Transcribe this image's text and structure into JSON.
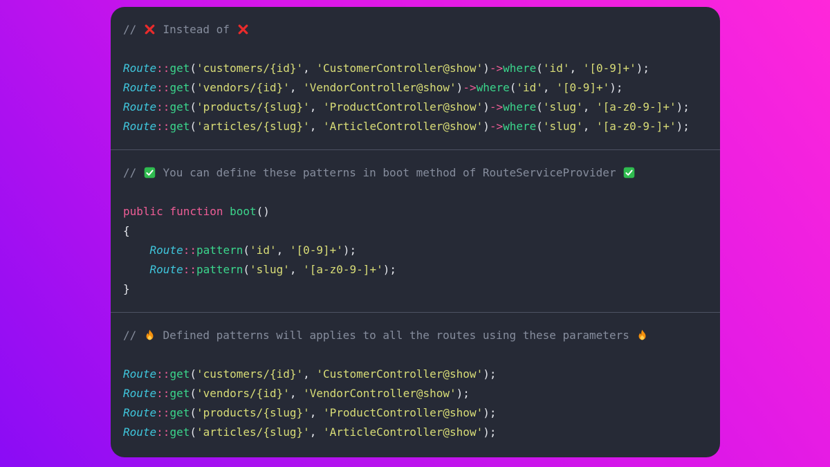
{
  "background": {
    "gradient_start": "#8a0cf5",
    "gradient_mid": "#d916e9",
    "gradient_end": "#ff27da"
  },
  "card": {
    "background": "#262a36",
    "divider_color": "#4d5263"
  },
  "syntax_colors": {
    "comment": "#868d9d",
    "class": "#3fc6dc",
    "op": "#ee5d96",
    "kw": "#ee5d96",
    "fn": "#3bd68c",
    "str": "#d9dd77",
    "plain": "#e4e6ec"
  },
  "icon_colors": {
    "cross": "#e92b2b",
    "check_background": "#2fbb4f",
    "check_mark": "#ffffff",
    "fire_outer": "#f4900c",
    "fire_inner": "#ffcc4d"
  },
  "sections": [
    {
      "name": "instead-of",
      "lines": [
        {
          "tokens": [
            {
              "t": "comment",
              "s": "// "
            },
            {
              "t": "cross-icon"
            },
            {
              "t": "comment",
              "s": " Instead of "
            },
            {
              "t": "cross-icon"
            }
          ]
        },
        {
          "tokens": []
        },
        {
          "tokens": [
            {
              "t": "class",
              "s": "Route"
            },
            {
              "t": "op",
              "s": "::"
            },
            {
              "t": "fn",
              "s": "get"
            },
            {
              "t": "plain",
              "s": "("
            },
            {
              "t": "str",
              "s": "'customers/{id}'"
            },
            {
              "t": "plain",
              "s": ", "
            },
            {
              "t": "str",
              "s": "'CustomerController@show'"
            },
            {
              "t": "plain",
              "s": ")"
            },
            {
              "t": "op",
              "s": "->"
            },
            {
              "t": "fn",
              "s": "where"
            },
            {
              "t": "plain",
              "s": "("
            },
            {
              "t": "str",
              "s": "'id'"
            },
            {
              "t": "plain",
              "s": ", "
            },
            {
              "t": "str",
              "s": "'[0-9]+'"
            },
            {
              "t": "plain",
              "s": ");"
            }
          ]
        },
        {
          "tokens": [
            {
              "t": "class",
              "s": "Route"
            },
            {
              "t": "op",
              "s": "::"
            },
            {
              "t": "fn",
              "s": "get"
            },
            {
              "t": "plain",
              "s": "("
            },
            {
              "t": "str",
              "s": "'vendors/{id}'"
            },
            {
              "t": "plain",
              "s": ", "
            },
            {
              "t": "str",
              "s": "'VendorController@show'"
            },
            {
              "t": "plain",
              "s": ")"
            },
            {
              "t": "op",
              "s": "->"
            },
            {
              "t": "fn",
              "s": "where"
            },
            {
              "t": "plain",
              "s": "("
            },
            {
              "t": "str",
              "s": "'id'"
            },
            {
              "t": "plain",
              "s": ", "
            },
            {
              "t": "str",
              "s": "'[0-9]+'"
            },
            {
              "t": "plain",
              "s": ");"
            }
          ]
        },
        {
          "tokens": [
            {
              "t": "class",
              "s": "Route"
            },
            {
              "t": "op",
              "s": "::"
            },
            {
              "t": "fn",
              "s": "get"
            },
            {
              "t": "plain",
              "s": "("
            },
            {
              "t": "str",
              "s": "'products/{slug}'"
            },
            {
              "t": "plain",
              "s": ", "
            },
            {
              "t": "str",
              "s": "'ProductController@show'"
            },
            {
              "t": "plain",
              "s": ")"
            },
            {
              "t": "op",
              "s": "->"
            },
            {
              "t": "fn",
              "s": "where"
            },
            {
              "t": "plain",
              "s": "("
            },
            {
              "t": "str",
              "s": "'slug'"
            },
            {
              "t": "plain",
              "s": ", "
            },
            {
              "t": "str",
              "s": "'[a-z0-9-]+'"
            },
            {
              "t": "plain",
              "s": ");"
            }
          ]
        },
        {
          "tokens": [
            {
              "t": "class",
              "s": "Route"
            },
            {
              "t": "op",
              "s": "::"
            },
            {
              "t": "fn",
              "s": "get"
            },
            {
              "t": "plain",
              "s": "("
            },
            {
              "t": "str",
              "s": "'articles/{slug}'"
            },
            {
              "t": "plain",
              "s": ", "
            },
            {
              "t": "str",
              "s": "'ArticleController@show'"
            },
            {
              "t": "plain",
              "s": ")"
            },
            {
              "t": "op",
              "s": "->"
            },
            {
              "t": "fn",
              "s": "where"
            },
            {
              "t": "plain",
              "s": "("
            },
            {
              "t": "str",
              "s": "'slug'"
            },
            {
              "t": "plain",
              "s": ", "
            },
            {
              "t": "str",
              "s": "'[a-z0-9-]+'"
            },
            {
              "t": "plain",
              "s": ");"
            }
          ]
        }
      ]
    },
    {
      "name": "define-patterns",
      "lines": [
        {
          "tokens": [
            {
              "t": "comment",
              "s": "// "
            },
            {
              "t": "check-icon"
            },
            {
              "t": "comment",
              "s": " You can define these patterns in boot method of RouteServiceProvider "
            },
            {
              "t": "check-icon"
            }
          ]
        },
        {
          "tokens": []
        },
        {
          "tokens": [
            {
              "t": "kw",
              "s": "public function "
            },
            {
              "t": "fn",
              "s": "boot"
            },
            {
              "t": "plain",
              "s": "()"
            }
          ]
        },
        {
          "tokens": [
            {
              "t": "plain",
              "s": "{"
            }
          ]
        },
        {
          "tokens": [
            {
              "t": "plain",
              "s": "    "
            },
            {
              "t": "class",
              "s": "Route"
            },
            {
              "t": "op",
              "s": "::"
            },
            {
              "t": "fn",
              "s": "pattern"
            },
            {
              "t": "plain",
              "s": "("
            },
            {
              "t": "str",
              "s": "'id'"
            },
            {
              "t": "plain",
              "s": ", "
            },
            {
              "t": "str",
              "s": "'[0-9]+'"
            },
            {
              "t": "plain",
              "s": ");"
            }
          ]
        },
        {
          "tokens": [
            {
              "t": "plain",
              "s": "    "
            },
            {
              "t": "class",
              "s": "Route"
            },
            {
              "t": "op",
              "s": "::"
            },
            {
              "t": "fn",
              "s": "pattern"
            },
            {
              "t": "plain",
              "s": "("
            },
            {
              "t": "str",
              "s": "'slug'"
            },
            {
              "t": "plain",
              "s": ", "
            },
            {
              "t": "str",
              "s": "'[a-z0-9-]+'"
            },
            {
              "t": "plain",
              "s": ");"
            }
          ]
        },
        {
          "tokens": [
            {
              "t": "plain",
              "s": "}"
            }
          ]
        }
      ]
    },
    {
      "name": "patterns-applied",
      "lines": [
        {
          "tokens": [
            {
              "t": "comment",
              "s": "// "
            },
            {
              "t": "fire-icon"
            },
            {
              "t": "comment",
              "s": " Defined patterns will applies to all the routes using these parameters "
            },
            {
              "t": "fire-icon"
            }
          ]
        },
        {
          "tokens": []
        },
        {
          "tokens": [
            {
              "t": "class",
              "s": "Route"
            },
            {
              "t": "op",
              "s": "::"
            },
            {
              "t": "fn",
              "s": "get"
            },
            {
              "t": "plain",
              "s": "("
            },
            {
              "t": "str",
              "s": "'customers/{id}'"
            },
            {
              "t": "plain",
              "s": ", "
            },
            {
              "t": "str",
              "s": "'CustomerController@show'"
            },
            {
              "t": "plain",
              "s": ");"
            }
          ]
        },
        {
          "tokens": [
            {
              "t": "class",
              "s": "Route"
            },
            {
              "t": "op",
              "s": "::"
            },
            {
              "t": "fn",
              "s": "get"
            },
            {
              "t": "plain",
              "s": "("
            },
            {
              "t": "str",
              "s": "'vendors/{id}'"
            },
            {
              "t": "plain",
              "s": ", "
            },
            {
              "t": "str",
              "s": "'VendorController@show'"
            },
            {
              "t": "plain",
              "s": ");"
            }
          ]
        },
        {
          "tokens": [
            {
              "t": "class",
              "s": "Route"
            },
            {
              "t": "op",
              "s": "::"
            },
            {
              "t": "fn",
              "s": "get"
            },
            {
              "t": "plain",
              "s": "("
            },
            {
              "t": "str",
              "s": "'products/{slug}'"
            },
            {
              "t": "plain",
              "s": ", "
            },
            {
              "t": "str",
              "s": "'ProductController@show'"
            },
            {
              "t": "plain",
              "s": ");"
            }
          ]
        },
        {
          "tokens": [
            {
              "t": "class",
              "s": "Route"
            },
            {
              "t": "op",
              "s": "::"
            },
            {
              "t": "fn",
              "s": "get"
            },
            {
              "t": "plain",
              "s": "("
            },
            {
              "t": "str",
              "s": "'articles/{slug}'"
            },
            {
              "t": "plain",
              "s": ", "
            },
            {
              "t": "str",
              "s": "'ArticleController@show'"
            },
            {
              "t": "plain",
              "s": ");"
            }
          ]
        }
      ]
    }
  ]
}
